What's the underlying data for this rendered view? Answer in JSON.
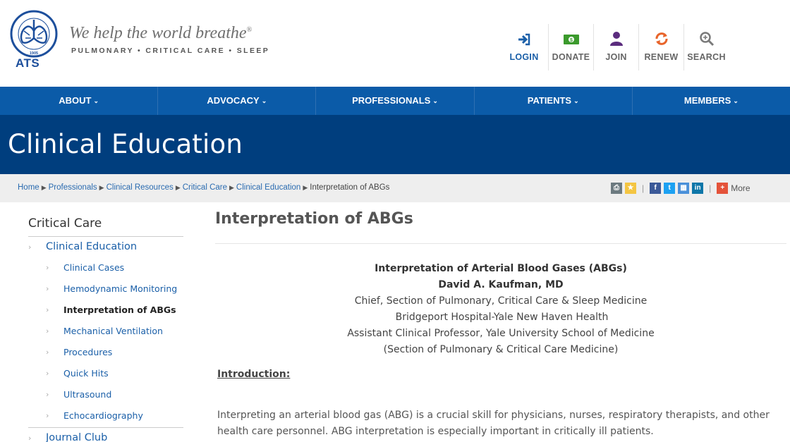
{
  "brand": {
    "logo_text": "ATS",
    "seal_text": "AMERICAN THORACIC SOCIETY • 1905",
    "tagline": "We help the world breathe",
    "tagline_mark": "®",
    "subtag": "PULMONARY • CRITICAL CARE • SLEEP"
  },
  "utility": [
    {
      "label": "LOGIN",
      "icon": "login-icon",
      "color": "#1a5fa8"
    },
    {
      "label": "DONATE",
      "icon": "donate-icon",
      "color": "#3b9a2c"
    },
    {
      "label": "JOIN",
      "icon": "person-icon",
      "color": "#5b2c7e"
    },
    {
      "label": "RENEW",
      "icon": "renew-icon",
      "color": "#e8642a"
    },
    {
      "label": "SEARCH",
      "icon": "search-icon",
      "color": "#7a7a7a"
    }
  ],
  "nav": [
    "ABOUT",
    "ADVOCACY",
    "PROFESSIONALS",
    "PATIENTS",
    "MEMBERS"
  ],
  "banner": {
    "title": "Clinical Education"
  },
  "breadcrumb": {
    "items": [
      "Home",
      "Professionals",
      "Clinical Resources",
      "Critical Care",
      "Clinical Education"
    ],
    "current": "Interpretation of ABGs"
  },
  "share": {
    "more_label": "More"
  },
  "sidebar": {
    "title": "Critical Care",
    "section": "Clinical Education",
    "items": [
      "Clinical Cases",
      "Hemodynamic Monitoring",
      "Interpretation of ABGs",
      "Mechanical Ventilation",
      "Procedures",
      "Quick Hits",
      "Ultrasound",
      "Echocardiography"
    ],
    "active_index": 2,
    "next_section": "Journal Club"
  },
  "article": {
    "title": "Interpretation of ABGs",
    "heading": "Interpretation of Arterial Blood Gases (ABGs)",
    "author": "David A. Kaufman, MD",
    "affiliations": [
      "Chief, Section of Pulmonary, Critical Care & Sleep Medicine",
      "Bridgeport Hospital-Yale New Haven Health",
      "Assistant Clinical Professor, Yale University School of Medicine",
      "(Section of Pulmonary & Critical Care Medicine)"
    ],
    "intro_heading": "Introduction:",
    "intro_text": "Interpreting an arterial blood gas (ABG) is a crucial skill for physicians, nurses, respiratory therapists, and other health care personnel. ABG interpretation is especially important in critically ill patients."
  }
}
